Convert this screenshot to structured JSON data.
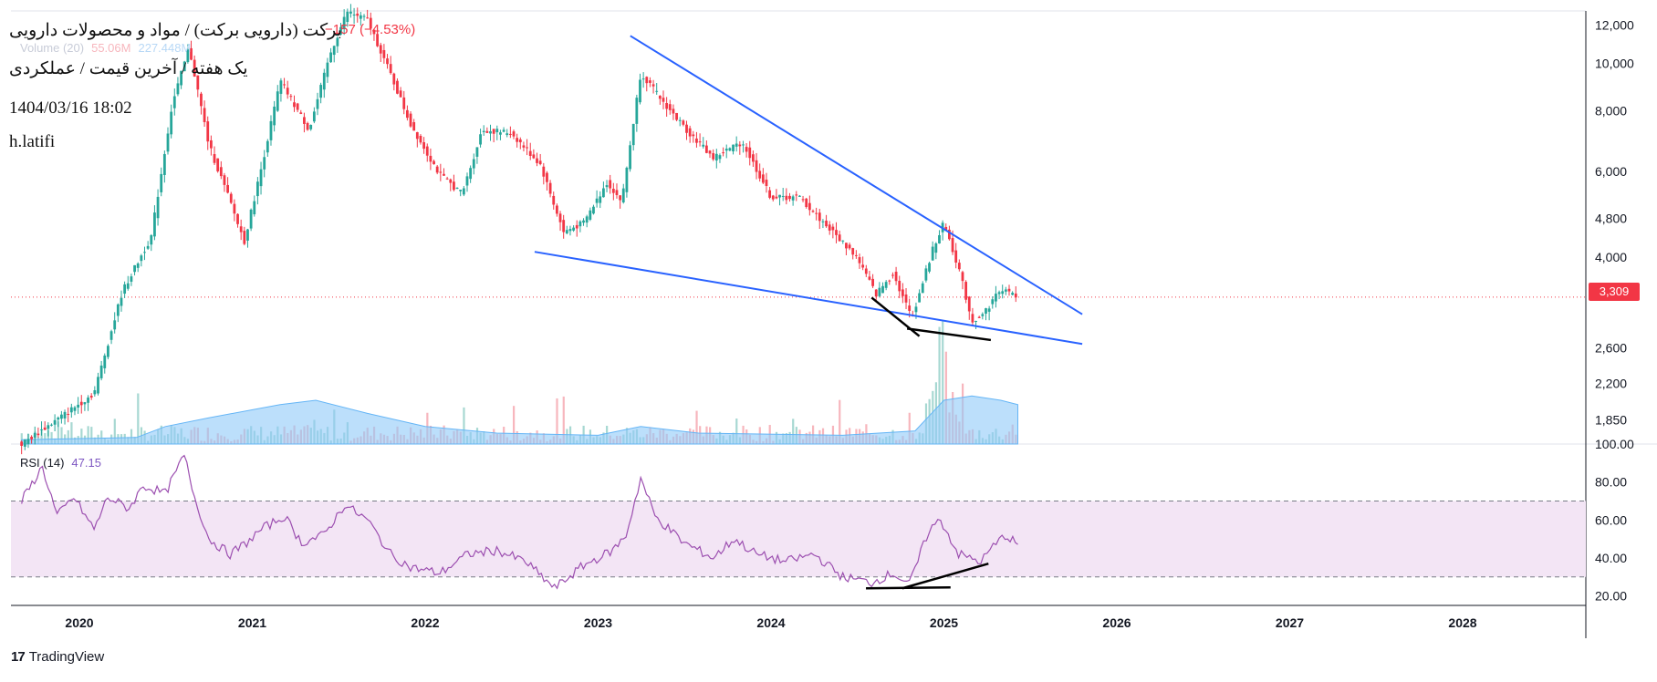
{
  "header": {
    "title": "برکت (دارویی برکت) / مواد و محصولات دارویی",
    "subtitle": "یک هفته / آخرین قیمت / عملکردی",
    "datetime": "1404/03/16 18:02",
    "author": "h.latifi",
    "change_text": "−157 (−4.53%)"
  },
  "volume_legend": {
    "label": "Volume (20)",
    "value1": "55.06M",
    "value2": "227.448M"
  },
  "rsi_legend": {
    "label": "RSI (14)",
    "value": "47.15"
  },
  "last_price_badge": "3,309",
  "brand": {
    "logo": "17",
    "name": "TradingView"
  },
  "colors": {
    "up": "#26a69a",
    "down": "#f23645",
    "trendline": "#2962ff",
    "annotation": "#000000",
    "volume_ma": "#90caf9",
    "rsi_line": "#9c4fb0",
    "rsi_band": "#f3e5f5",
    "grid": "#e0e3eb",
    "axis_text": "#131722"
  },
  "chart_data": [
    {
      "type": "candlestick",
      "interval": "1W",
      "y_scale": "log",
      "ylim": [
        1650,
        12500
      ],
      "y_ticks": [
        "12,000",
        "10,000",
        "8,000",
        "6,000",
        "4,800",
        "4,000",
        "3,309",
        "2,600",
        "2,200",
        "1,850"
      ],
      "x_ticks": [
        "2020",
        "2021",
        "2022",
        "2023",
        "2024",
        "2025",
        "2026",
        "2027",
        "2028"
      ],
      "last_price": 3309,
      "price_path": [
        [
          "2019-09-01",
          1650
        ],
        [
          "2019-12-01",
          1900
        ],
        [
          "2020-02-01",
          2100
        ],
        [
          "2020-04-01",
          3400
        ],
        [
          "2020-06-01",
          4400
        ],
        [
          "2020-07-15",
          8200
        ],
        [
          "2020-08-20",
          10800
        ],
        [
          "2020-10-01",
          6800
        ],
        [
          "2020-11-15",
          5200
        ],
        [
          "2020-12-15",
          4300
        ],
        [
          "2021-01-20",
          6100
        ],
        [
          "2021-03-01",
          9200
        ],
        [
          "2021-05-01",
          7300
        ],
        [
          "2021-06-15",
          10500
        ],
        [
          "2021-07-20",
          12800
        ],
        [
          "2021-09-01",
          12300
        ],
        [
          "2021-10-20",
          9500
        ],
        [
          "2021-12-01",
          7500
        ],
        [
          "2022-02-01",
          5900
        ],
        [
          "2022-03-20",
          5400
        ],
        [
          "2022-05-01",
          7300
        ],
        [
          "2022-07-01",
          7200
        ],
        [
          "2022-09-01",
          6200
        ],
        [
          "2022-10-20",
          4500
        ],
        [
          "2022-12-01",
          4700
        ],
        [
          "2023-01-20",
          5700
        ],
        [
          "2023-02-20",
          5200
        ],
        [
          "2023-04-01",
          9600
        ],
        [
          "2023-05-15",
          8400
        ],
        [
          "2023-07-01",
          7400
        ],
        [
          "2023-09-01",
          6400
        ],
        [
          "2023-11-01",
          6900
        ],
        [
          "2024-01-01",
          5300
        ],
        [
          "2024-03-01",
          5300
        ],
        [
          "2024-05-01",
          4600
        ],
        [
          "2024-07-01",
          4000
        ],
        [
          "2024-08-10",
          3350
        ],
        [
          "2024-09-15",
          3700
        ],
        [
          "2024-10-25",
          3000
        ],
        [
          "2024-12-10",
          4200
        ],
        [
          "2025-01-01",
          4700
        ],
        [
          "2025-02-01",
          3800
        ],
        [
          "2025-03-01",
          2950
        ],
        [
          "2025-03-25",
          3050
        ],
        [
          "2025-05-01",
          3450
        ],
        [
          "2025-06-06",
          3309
        ]
      ],
      "trendlines": [
        {
          "name": "upper-trendline",
          "from": [
            "2023-03-10",
            11400
          ],
          "to": [
            "2025-10-20",
            3050
          ]
        },
        {
          "name": "lower-trendline",
          "from": [
            "2022-08-20",
            4100
          ],
          "to": [
            "2025-10-20",
            2650
          ]
        },
        {
          "name": "divergence-price-1",
          "from": [
            "2024-08-01",
            3300
          ],
          "to": [
            "2024-11-10",
            2750
          ]
        },
        {
          "name": "divergence-price-2",
          "from": [
            "2024-10-15",
            2850
          ],
          "to": [
            "2025-04-10",
            2700
          ]
        }
      ]
    },
    {
      "type": "area",
      "name": "Volume (20)",
      "ma_path": [
        [
          "2019-09-01",
          0.02
        ],
        [
          "2020-05-01",
          0.03
        ],
        [
          "2020-07-01",
          0.08
        ],
        [
          "2020-10-01",
          0.12
        ],
        [
          "2021-03-01",
          0.18
        ],
        [
          "2021-05-15",
          0.2
        ],
        [
          "2021-09-01",
          0.14
        ],
        [
          "2022-01-01",
          0.08
        ],
        [
          "2022-06-01",
          0.05
        ],
        [
          "2023-01-01",
          0.04
        ],
        [
          "2023-04-01",
          0.08
        ],
        [
          "2023-08-01",
          0.05
        ],
        [
          "2024-06-01",
          0.04
        ],
        [
          "2024-11-01",
          0.06
        ],
        [
          "2025-01-01",
          0.2
        ],
        [
          "2025-03-01",
          0.22
        ],
        [
          "2025-05-01",
          0.2
        ],
        [
          "2025-06-06",
          0.18
        ]
      ]
    },
    {
      "type": "line",
      "name": "RSI (14)",
      "ylim": [
        15,
        100
      ],
      "y_ticks": [
        "100.00",
        "80.00",
        "60.00",
        "40.00",
        "20.00"
      ],
      "bands": [
        30,
        70
      ],
      "last_value": 47.15,
      "path": [
        [
          "2019-09-01",
          70
        ],
        [
          "2019-10-15",
          88
        ],
        [
          "2019-11-15",
          62
        ],
        [
          "2019-12-20",
          72
        ],
        [
          "2020-02-01",
          55
        ],
        [
          "2020-03-01",
          72
        ],
        [
          "2020-04-15",
          66
        ],
        [
          "2020-05-15",
          78
        ],
        [
          "2020-07-01",
          74
        ],
        [
          "2020-08-10",
          94
        ],
        [
          "2020-09-01",
          72
        ],
        [
          "2020-10-01",
          50
        ],
        [
          "2020-11-15",
          42
        ],
        [
          "2020-12-20",
          48
        ],
        [
          "2021-01-20",
          55
        ],
        [
          "2021-03-10",
          62
        ],
        [
          "2021-04-15",
          48
        ],
        [
          "2021-06-01",
          52
        ],
        [
          "2021-07-15",
          68
        ],
        [
          "2021-09-01",
          60
        ],
        [
          "2021-10-20",
          42
        ],
        [
          "2021-12-01",
          35
        ],
        [
          "2022-02-01",
          32
        ],
        [
          "2022-04-01",
          42
        ],
        [
          "2022-06-01",
          44
        ],
        [
          "2022-08-01",
          38
        ],
        [
          "2022-10-01",
          24
        ],
        [
          "2022-12-01",
          36
        ],
        [
          "2023-02-01",
          44
        ],
        [
          "2023-03-01",
          52
        ],
        [
          "2023-04-01",
          82
        ],
        [
          "2023-05-01",
          62
        ],
        [
          "2023-07-01",
          48
        ],
        [
          "2023-09-01",
          40
        ],
        [
          "2023-10-15",
          50
        ],
        [
          "2023-12-01",
          42
        ],
        [
          "2024-02-01",
          38
        ],
        [
          "2024-04-01",
          42
        ],
        [
          "2024-06-01",
          30
        ],
        [
          "2024-08-01",
          27
        ],
        [
          "2024-09-15",
          32
        ],
        [
          "2024-10-20",
          26
        ],
        [
          "2024-12-01",
          55
        ],
        [
          "2024-12-25",
          60
        ],
        [
          "2025-02-01",
          42
        ],
        [
          "2025-03-20",
          38
        ],
        [
          "2025-04-15",
          46
        ],
        [
          "2025-05-10",
          52
        ],
        [
          "2025-06-06",
          47.15
        ]
      ],
      "trendlines": [
        {
          "name": "rsi-divergence-1",
          "from": [
            "2024-07-20",
            24
          ],
          "to": [
            "2025-01-15",
            24.5
          ]
        },
        {
          "name": "rsi-divergence-2",
          "from": [
            "2024-10-05",
            24
          ],
          "to": [
            "2025-04-05",
            37
          ]
        }
      ]
    }
  ]
}
